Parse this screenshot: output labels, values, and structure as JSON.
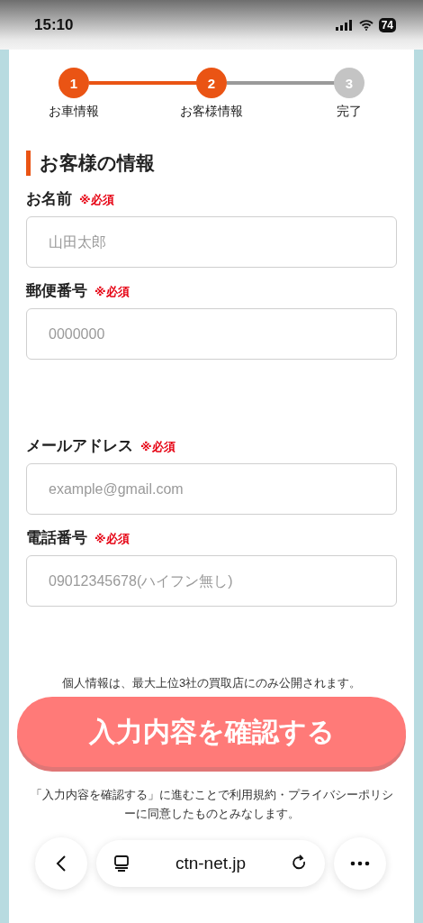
{
  "status_bar": {
    "time": "15:10",
    "battery": "74"
  },
  "steps": [
    {
      "number": "1",
      "label": "お車情報",
      "reached": true
    },
    {
      "number": "2",
      "label": "お客様情報",
      "reached": true
    },
    {
      "number": "3",
      "label": "完了",
      "reached": false
    }
  ],
  "heading": "お客様の情報",
  "sections": [
    [
      {
        "label": "お名前",
        "required": "※必須",
        "placeholder": "山田太郎"
      },
      {
        "label": "郵便番号",
        "required": "※必須",
        "placeholder": "0000000"
      }
    ],
    [
      {
        "label": "メールアドレス",
        "required": "※必須",
        "placeholder": "example@gmail.com"
      },
      {
        "label": "電話番号",
        "required": "※必須",
        "placeholder": "09012345678(ハイフン無し)"
      }
    ]
  ],
  "notice": "個人情報は、最大上位3社の買取店にのみ公開されます。",
  "submit_button": "入力内容を確認する",
  "terms": "「入力内容を確認する」に進むことで利用規約・プライバシーポリシーに同意したものとみなします。",
  "browser_bar": {
    "url": "ctn-net.jp"
  }
}
